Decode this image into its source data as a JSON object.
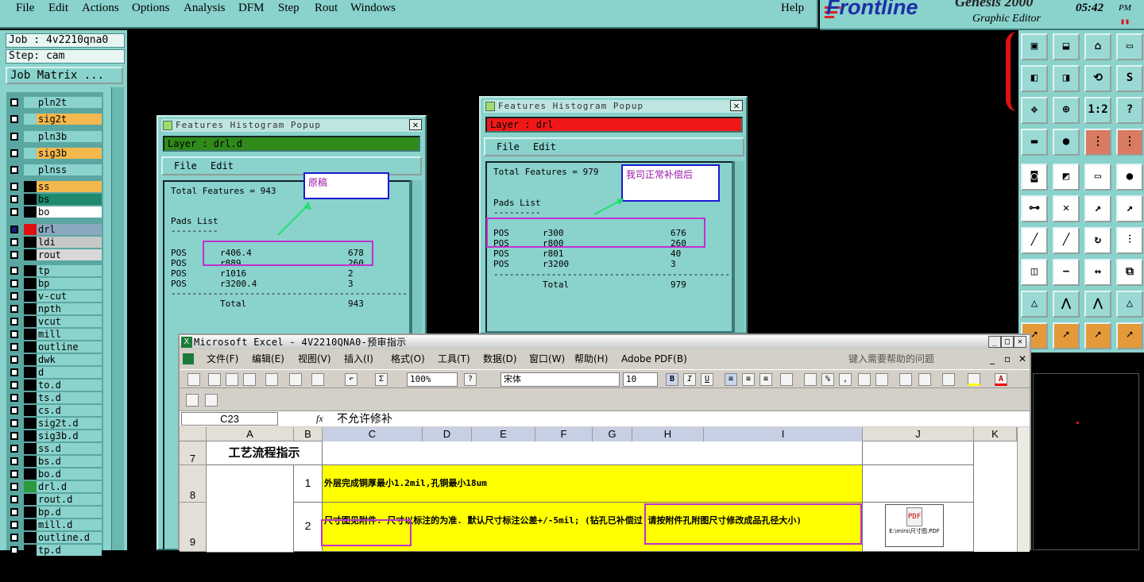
{
  "menubar": {
    "items": [
      "File",
      "Edit",
      "Actions",
      "Options",
      "Analysis",
      "DFM",
      "Step",
      "Rout",
      "Windows"
    ],
    "help": "Help"
  },
  "brand": {
    "logo": "Frontline",
    "product": "Genesis 2000",
    "subtitle": "Graphic Editor",
    "time": "05:42",
    "ampm": "PM"
  },
  "job": {
    "job_line": "Job : 4v2210qna0",
    "step_line": "Step: cam",
    "matrix_button": "Job Matrix ..."
  },
  "layers": [
    {
      "name": "pln2t",
      "color": "#8ad2cc",
      "bg": "#8ad2cc"
    },
    {
      "name": "sig2t",
      "color": "#8ad2cc",
      "bg": "#f5b84e"
    },
    {
      "name": "pln3b",
      "color": "#8ad2cc",
      "bg": "#8ad2cc"
    },
    {
      "name": "sig3b",
      "color": "#8ad2cc",
      "bg": "#f5b84e"
    },
    {
      "name": "plnss",
      "color": "#8ad2cc",
      "bg": "#8ad2cc"
    },
    {
      "name": "ss",
      "color": "#000000",
      "bg": "#f5b84e"
    },
    {
      "name": "bs",
      "color": "#000000",
      "bg": "#1f8a6e"
    },
    {
      "name": "bo",
      "color": "#000000",
      "bg": "#ffffff"
    },
    {
      "name": "drl",
      "color": "#e01010",
      "bg": "#8aa8c0"
    },
    {
      "name": "ldi",
      "color": "#000000",
      "bg": "#c8c8c8"
    },
    {
      "name": "rout",
      "color": "#000000",
      "bg": "#d8d8d8"
    },
    {
      "name": "tp",
      "color": "#000000",
      "bg": "#8ad2cc"
    },
    {
      "name": "bp",
      "color": "#000000",
      "bg": "#8ad2cc"
    },
    {
      "name": "v-cut",
      "color": "#000000",
      "bg": "#8ad2cc"
    },
    {
      "name": "npth",
      "color": "#000000",
      "bg": "#8ad2cc"
    },
    {
      "name": "vcut",
      "color": "#000000",
      "bg": "#8ad2cc"
    },
    {
      "name": "mill",
      "color": "#000000",
      "bg": "#8ad2cc"
    },
    {
      "name": "outline",
      "color": "#000000",
      "bg": "#8ad2cc"
    },
    {
      "name": "dwk",
      "color": "#000000",
      "bg": "#8ad2cc"
    },
    {
      "name": "d",
      "color": "#000000",
      "bg": "#8ad2cc"
    },
    {
      "name": "to.d",
      "color": "#000000",
      "bg": "#8ad2cc"
    },
    {
      "name": "ts.d",
      "color": "#000000",
      "bg": "#8ad2cc"
    },
    {
      "name": "cs.d",
      "color": "#000000",
      "bg": "#8ad2cc"
    },
    {
      "name": "sig2t.d",
      "color": "#000000",
      "bg": "#8ad2cc"
    },
    {
      "name": "sig3b.d",
      "color": "#000000",
      "bg": "#8ad2cc"
    },
    {
      "name": "ss.d",
      "color": "#000000",
      "bg": "#8ad2cc"
    },
    {
      "name": "bs.d",
      "color": "#000000",
      "bg": "#8ad2cc"
    },
    {
      "name": "bo.d",
      "color": "#000000",
      "bg": "#8ad2cc"
    },
    {
      "name": "drl.d",
      "color": "#2a9a3a",
      "bg": "#8ad2cc"
    },
    {
      "name": "rout.d",
      "color": "#000000",
      "bg": "#8ad2cc"
    },
    {
      "name": "bp.d",
      "color": "#000000",
      "bg": "#8ad2cc"
    },
    {
      "name": "mill.d",
      "color": "#000000",
      "bg": "#8ad2cc"
    },
    {
      "name": "outline.d",
      "color": "#000000",
      "bg": "#8ad2cc"
    },
    {
      "name": "tp.d",
      "color": "#000000",
      "bg": "#8ad2cc"
    }
  ],
  "popup_left": {
    "title": "Features Histogram Popup",
    "layer_label": "Layer : drl.d",
    "layer_color": "#2f8a1a",
    "menu": [
      "File",
      "Edit"
    ],
    "total_line": "Total Features = 943",
    "pads_header": "Pads List",
    "pads_rule": "---------",
    "rows": [
      {
        "kind": "POS",
        "sym": "r406.4",
        "count": "678"
      },
      {
        "kind": "POS",
        "sym": "r889",
        "count": "260"
      },
      {
        "kind": "POS",
        "sym": "r1016",
        "count": "2"
      },
      {
        "kind": "POS",
        "sym": "r3200.4",
        "count": "3"
      }
    ],
    "rule": "---------------------------------------------",
    "total_label": "Total",
    "total_value": "943",
    "annotation": "原稿"
  },
  "popup_right": {
    "title": "Features Histogram Popup",
    "layer_label": "Layer : drl",
    "layer_color": "#f01818",
    "menu": [
      "File",
      "Edit"
    ],
    "total_line": "Total Features = 979",
    "pads_header": "Pads List",
    "pads_rule": "---------",
    "rows": [
      {
        "kind": "POS",
        "sym": "r300",
        "count": "676"
      },
      {
        "kind": "POS",
        "sym": "r800",
        "count": "260"
      },
      {
        "kind": "POS",
        "sym": "r801",
        "count": "40"
      },
      {
        "kind": "POS",
        "sym": "r3200",
        "count": "3"
      }
    ],
    "rule": "---------------------------------------------",
    "total_label": "Total",
    "total_value": "979",
    "annotation": "我司正常补偿后"
  },
  "toolpanel": {
    "rows": [
      [
        "fit-icon",
        "save-view-icon",
        "home-icon",
        "window-icon"
      ],
      [
        "pan-left-icon",
        "pan-right-icon",
        "redraw-icon",
        "zoom-s-icon"
      ],
      [
        "zoom-fit-icon",
        "zoom-center-icon",
        "scale-icon",
        "help-icon"
      ],
      [
        "ruler-icon",
        "snap-icon",
        "layers-a-icon",
        "layers-b-icon"
      ],
      [
        "select-pad-icon",
        "highlight-icon",
        "measure-icon",
        "circle-icon"
      ],
      [
        "connect-icon",
        "cross-icon",
        "line-icon",
        "line-dot-icon"
      ],
      [
        "slash-icon",
        "slash-red-icon",
        "arc-icon",
        "split-icon"
      ],
      [
        "pad-add-icon",
        "minus-icon",
        "dimension-icon",
        "group-icon"
      ],
      [
        "triangle-a-icon",
        "triangle-b-icon",
        "triangle-c-icon",
        "triangle-d-icon"
      ],
      [
        "arrow-a-icon",
        "arrow-b-icon",
        "arrow-c-icon",
        "arrow-d-icon"
      ]
    ],
    "labels": {
      "scale": "1:2",
      "help": "?",
      "zoom_s": "S"
    }
  },
  "excel": {
    "title": "Microsoft Excel - 4V2210QNA0-预审指示",
    "menu": [
      "文件(F)",
      "编辑(E)",
      "视图(V)",
      "插入(I)",
      "格式(O)",
      "工具(T)",
      "数据(D)",
      "窗口(W)",
      "帮助(H)",
      "Adobe PDF(B)"
    ],
    "help_box": "键入需要帮助的问题",
    "zoom": "100%",
    "font_name": "宋体",
    "font_size": "10",
    "name_box": "C23",
    "fx": "fx",
    "formula": "不允许修补",
    "columns": [
      "A",
      "B",
      "C",
      "D",
      "E",
      "F",
      "G",
      "H",
      "I",
      "J",
      "K"
    ],
    "rows": {
      "r7": {
        "num": "7",
        "a": "工艺流程指示"
      },
      "r8": {
        "num": "8",
        "b": "1",
        "c": "外层完成铜厚最小1.2mil,孔铜最小18um"
      },
      "r9": {
        "num": "9",
        "b": "2",
        "c": "尺寸图见附件. 尺寸以标注的为准. 默认尺寸标注公差+/-5mil; (钻孔已补偿过,请按附件孔附图尺寸修改成品孔径大小)",
        "pdf_label": "E:\\mirs\\尺寸图.PDF"
      }
    }
  }
}
